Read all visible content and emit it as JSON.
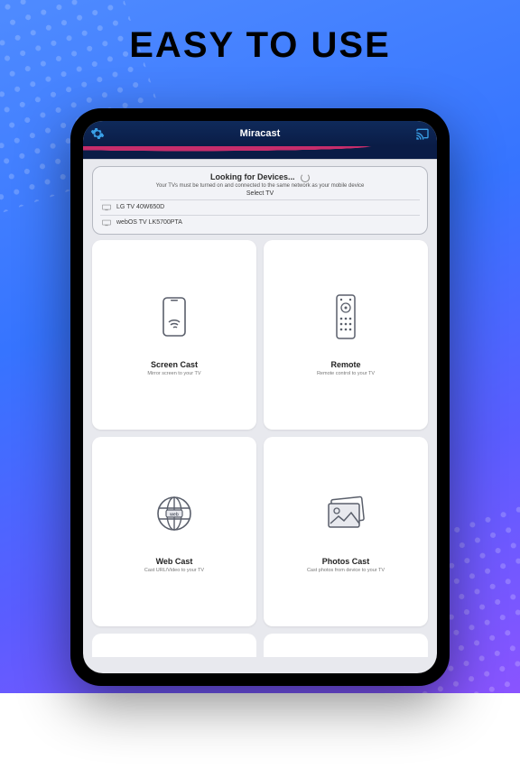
{
  "headline": "EASY TO USE",
  "app": {
    "title": "Miracast"
  },
  "panel": {
    "looking": "Looking for Devices...",
    "subtitle": "Your TVs must be turned on and connected to the same network as your mobile device",
    "select": "Select TV",
    "devices": [
      {
        "name": "LG TV 40W650D"
      },
      {
        "name": "webOS TV LK5700PTA"
      }
    ]
  },
  "cards": {
    "screen": {
      "title": "Screen Cast",
      "sub": "Mirror screen to your TV"
    },
    "remote": {
      "title": "Remote",
      "sub": "Remote control to your TV"
    },
    "web": {
      "title": "Web Cast",
      "sub": "Cast URL/Video to your TV"
    },
    "photos": {
      "title": "Photos Cast",
      "sub": "Cast photos from device to your TV"
    }
  }
}
